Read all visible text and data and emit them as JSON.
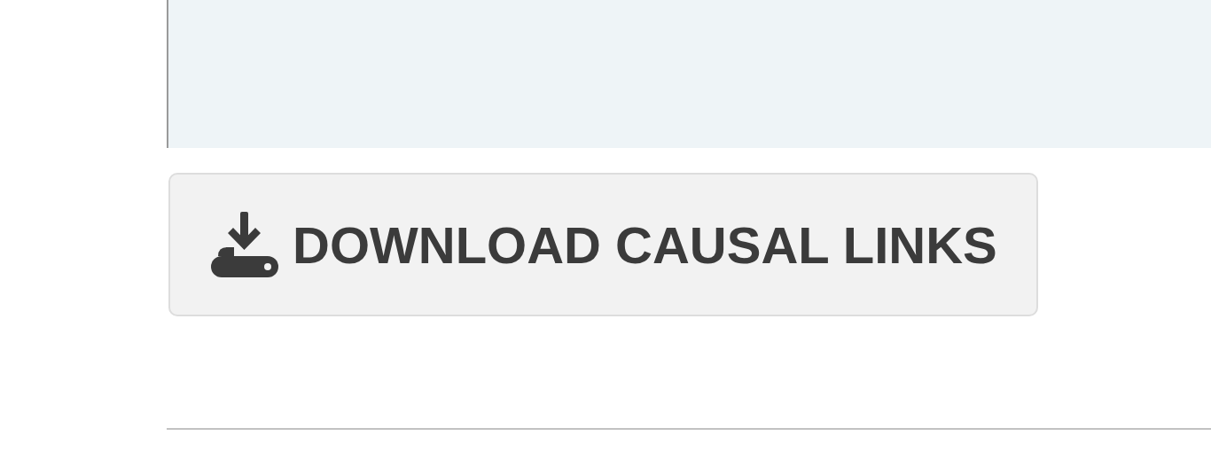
{
  "download_button": {
    "label": "DOWNLOAD CAUSAL LINKS"
  }
}
